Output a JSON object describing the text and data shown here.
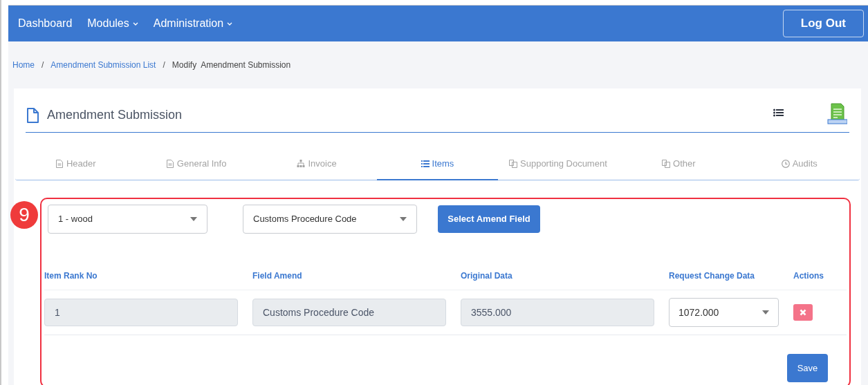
{
  "nav": {
    "items": [
      {
        "label": "Dashboard",
        "dropdown": false
      },
      {
        "label": "Modules",
        "dropdown": true
      },
      {
        "label": "Administration",
        "dropdown": true
      }
    ],
    "logout": "Log Out"
  },
  "breadcrumb": [
    {
      "label": "Home",
      "link": true
    },
    {
      "label": "Amendment Submission List",
      "link": true
    },
    {
      "label": "Modify  Amendment Submission",
      "link": false
    }
  ],
  "breadcrumb_separator": "/",
  "card": {
    "title": "Amendment Submission"
  },
  "tabs": [
    {
      "label": "Header",
      "selected": false
    },
    {
      "label": "General Info",
      "selected": false
    },
    {
      "label": "Invoice",
      "selected": false
    },
    {
      "label": "Items",
      "selected": true
    },
    {
      "label": "Supporting Document",
      "selected": false
    },
    {
      "label": "Other",
      "selected": false
    },
    {
      "label": "Audits",
      "selected": false
    }
  ],
  "annotation": {
    "number": "9"
  },
  "filters": {
    "item": "1 - wood",
    "field": "Customs Procedure Code",
    "button": "Select Amend Field"
  },
  "table": {
    "columns": [
      "Item Rank No",
      "Field Amend",
      "Original Data",
      "Request Change Data",
      "Actions"
    ],
    "rows": [
      {
        "cells": [
          {
            "kind": "readonly",
            "value": "1"
          },
          {
            "kind": "readonly",
            "value": "Customs Procedure Code"
          },
          {
            "kind": "readonly",
            "value": "3555.000"
          },
          {
            "kind": "select",
            "value": "1072.000"
          },
          {
            "kind": "delete"
          }
        ]
      }
    ]
  },
  "save": "Save"
}
